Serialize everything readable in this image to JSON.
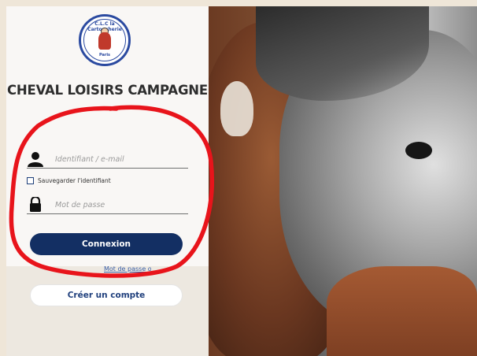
{
  "brand": {
    "logo_top_text": "C.L.C la Cartoucherie",
    "logo_bottom_text": "Paris",
    "site_title": "CHEVAL LOISIRS CAMPAGNE"
  },
  "login_form": {
    "username_placeholder": "Identifiant / e-mail",
    "remember_label": "Sauvegarder l'identifiant",
    "remember_checked": false,
    "password_placeholder": "Mot de passe",
    "login_button": "Connexion",
    "forgot_link": "Mot de passe oublié",
    "create_account_button": "Créer un compte"
  },
  "icons": {
    "user": "user-icon",
    "lock": "lock-icon"
  },
  "colors": {
    "primary_button": "#132f63",
    "annotation": "#e8141b",
    "logo_blue": "#2b4aa0"
  }
}
